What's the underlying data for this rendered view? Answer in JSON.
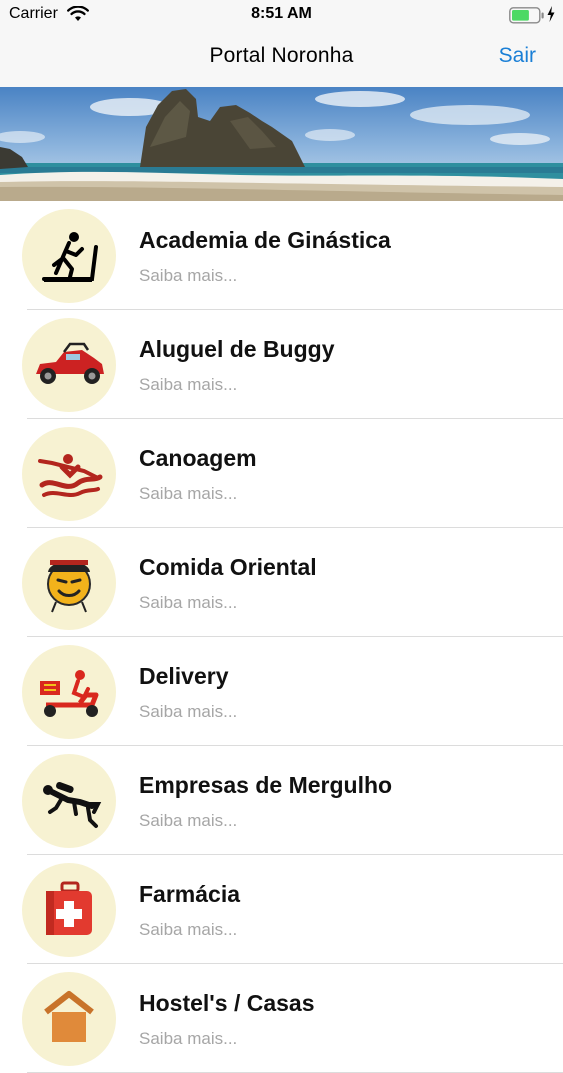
{
  "status_bar": {
    "carrier": "Carrier",
    "time": "8:51 AM",
    "battery_level": 0.65,
    "battery_color": "#4cd964"
  },
  "nav": {
    "title": "Portal Noronha",
    "action_label": "Sair",
    "action_color": "#1a7fd6"
  },
  "banner": {
    "image": "beach-rocks-photo"
  },
  "list": {
    "items": [
      {
        "title": "Academia de Ginástica",
        "subtitle": "Saiba mais...",
        "icon": "treadmill-icon"
      },
      {
        "title": "Aluguel de Buggy",
        "subtitle": "Saiba mais...",
        "icon": "buggy-icon"
      },
      {
        "title": "Canoagem",
        "subtitle": "Saiba mais...",
        "icon": "kayak-icon"
      },
      {
        "title": "Comida Oriental",
        "subtitle": "Saiba mais...",
        "icon": "oriental-food-icon"
      },
      {
        "title": "Delivery",
        "subtitle": "Saiba mais...",
        "icon": "delivery-scooter-icon"
      },
      {
        "title": "Empresas de Mergulho",
        "subtitle": "Saiba mais...",
        "icon": "diver-icon"
      },
      {
        "title": "Farmácia",
        "subtitle": "Saiba mais...",
        "icon": "first-aid-kit-icon"
      },
      {
        "title": "Hostel's / Casas",
        "subtitle": "Saiba mais...",
        "icon": "house-icon"
      }
    ]
  },
  "colors": {
    "icon_circle_bg": "#f7f2d2",
    "subtitle_gray": "#a6a6a6",
    "separator": "#dcdcdc"
  }
}
